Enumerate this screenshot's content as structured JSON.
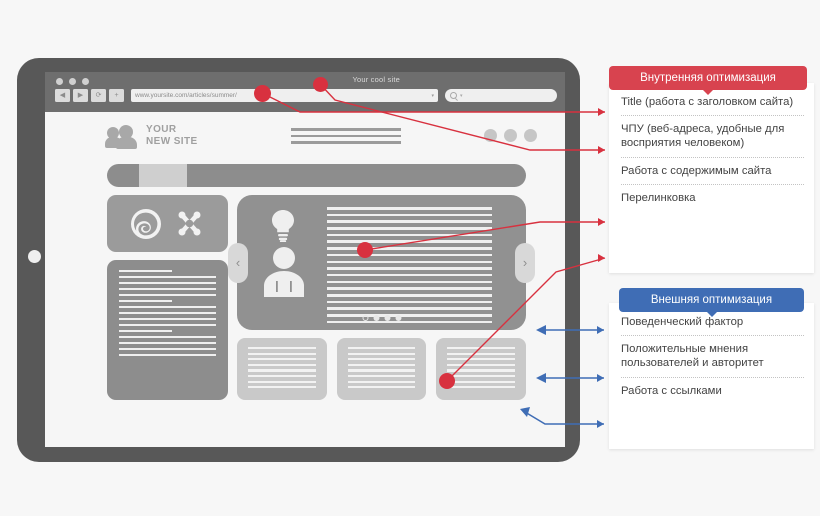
{
  "browser": {
    "tab_title": "Your cool site",
    "url": "www.yoursite.com/articles/summer/",
    "url_caret": "▾",
    "search_caret": "▾",
    "buttons": [
      {
        "name": "back-button",
        "glyph": "◀"
      },
      {
        "name": "forward-button",
        "glyph": "▶"
      },
      {
        "name": "reload-button",
        "glyph": "⟳"
      },
      {
        "name": "new-tab-button",
        "glyph": "+"
      }
    ]
  },
  "site": {
    "logo_line1": "YOUR",
    "logo_line2": "NEW SITE",
    "carousel": {
      "prev": "‹",
      "next": "›",
      "dot_count": 4,
      "active_dot": 0
    }
  },
  "panels": {
    "internal": {
      "badge": "Внутренняя оптимизация",
      "badge_color": "#d8434f",
      "items": [
        "Title (работа с заголовком сайта)",
        "ЧПУ (веб-адреса, удобные для восприятия человеком)",
        "Работа с содержимым сайта",
        "Перелинковка"
      ]
    },
    "external": {
      "badge": "Внешняя оптимизация",
      "badge_color": "#3f6db5",
      "items": [
        "Поведенческий фактор",
        "Положительные мнения пользователей и авторитет",
        "Работа с ссылками"
      ]
    }
  },
  "colors": {
    "accent_red": "#d8434f",
    "accent_blue": "#3f6db5",
    "dot_red": "#d8313f",
    "bezel": "#585858",
    "page_bg": "#f7f7f7"
  }
}
